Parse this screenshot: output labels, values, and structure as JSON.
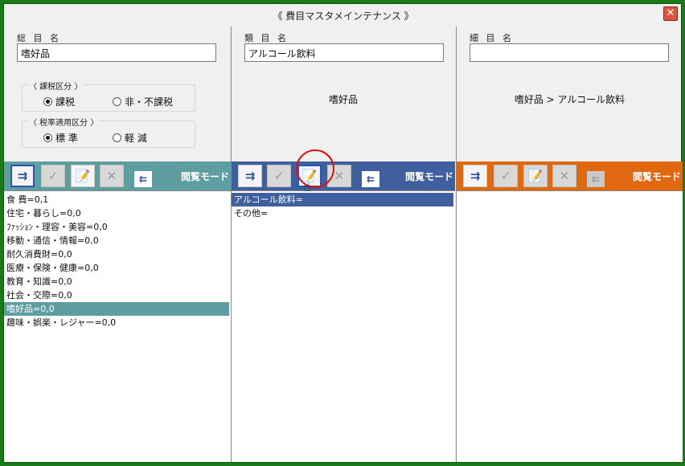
{
  "window": {
    "title": "《 費目マスタメインテナンス 》",
    "close_icon": "close-icon"
  },
  "col1": {
    "label": "総 目 名",
    "value": "嗜好品",
    "tax_group": {
      "label": "〈 課税区分 〉",
      "options": [
        "課税",
        "非・不課税"
      ],
      "selected": 0
    },
    "rate_group": {
      "label": "〈 税率適用区分 〉",
      "options": [
        "標 準",
        "軽 減"
      ],
      "selected": 0
    },
    "mode_label": "閲覧モード",
    "toolbar_color": "#5f9ea0",
    "items": [
      "食 費=0,1",
      "住宅・暮らし=0,0",
      "ﾌｧｯｼｮﾝ・理容・美容=0,0",
      "移動・通信・情報=0,0",
      "耐久消費財=0,0",
      "医療・保険・健康=0,0",
      "教育・知識=0,0",
      "社会・交際=0,0",
      "嗜好品=0,0",
      "趣味・娯楽・レジャー=0,0"
    ],
    "selected_index": 8
  },
  "col2": {
    "label": "類 目 名",
    "value": "アルコール飲料",
    "crumb": "嗜好品",
    "mode_label": "閲覧モード",
    "toolbar_color": "#3f5f9f",
    "items": [
      "アルコール飲料=",
      "その他="
    ],
    "selected_index": 0
  },
  "col3": {
    "label": "細 目 名",
    "value": "",
    "crumb": "嗜好品 > アルコール飲料",
    "mode_label": "閲覧モード",
    "toolbar_color": "#e06810",
    "items": []
  }
}
